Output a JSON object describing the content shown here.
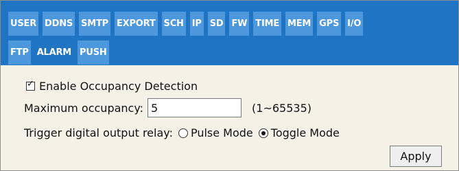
{
  "tabs": {
    "row1": [
      "USER",
      "DDNS",
      "SMTP",
      "EXPORT",
      "SCH",
      "IP",
      "SD",
      "FW",
      "TIME",
      "MEM",
      "GPS",
      "I/O"
    ],
    "row2": [
      "FTP",
      "ALARM",
      "PUSH"
    ],
    "active": "ALARM"
  },
  "occupancy": {
    "enable_label": "Enable Occupancy Detection",
    "enable_checked": true,
    "max_label": "Maximum occupancy:",
    "max_value": "5",
    "max_range": "(1~65535)",
    "trigger_label": "Trigger digital output relay:",
    "pulse_label": "Pulse Mode",
    "toggle_label": "Toggle Mode",
    "selected_mode": "Toggle Mode",
    "apply_label": "Apply"
  },
  "colors": {
    "tabbar": "#1f74c3",
    "tab": "#4d97dd",
    "content_bg": "#f6f1e6"
  }
}
